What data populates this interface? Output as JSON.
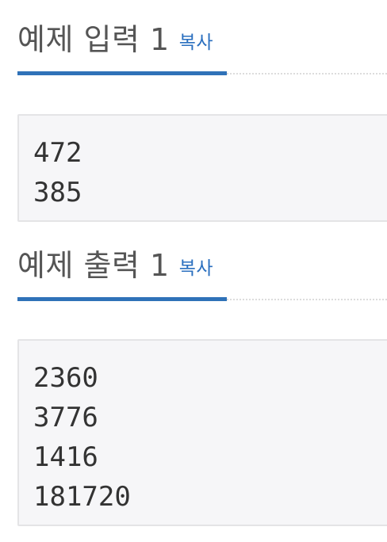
{
  "input_section": {
    "title": "예제 입력 1",
    "copy_label": "복사",
    "lines": [
      "472",
      "385"
    ]
  },
  "output_section": {
    "title": "예제 출력 1",
    "copy_label": "복사",
    "lines": [
      "2360",
      "3776",
      "1416",
      "181720"
    ]
  },
  "colors": {
    "accent": "#2f72b8",
    "link": "#2a6fbf",
    "box_background": "#f6f6f8",
    "heading_text": "#555555"
  }
}
